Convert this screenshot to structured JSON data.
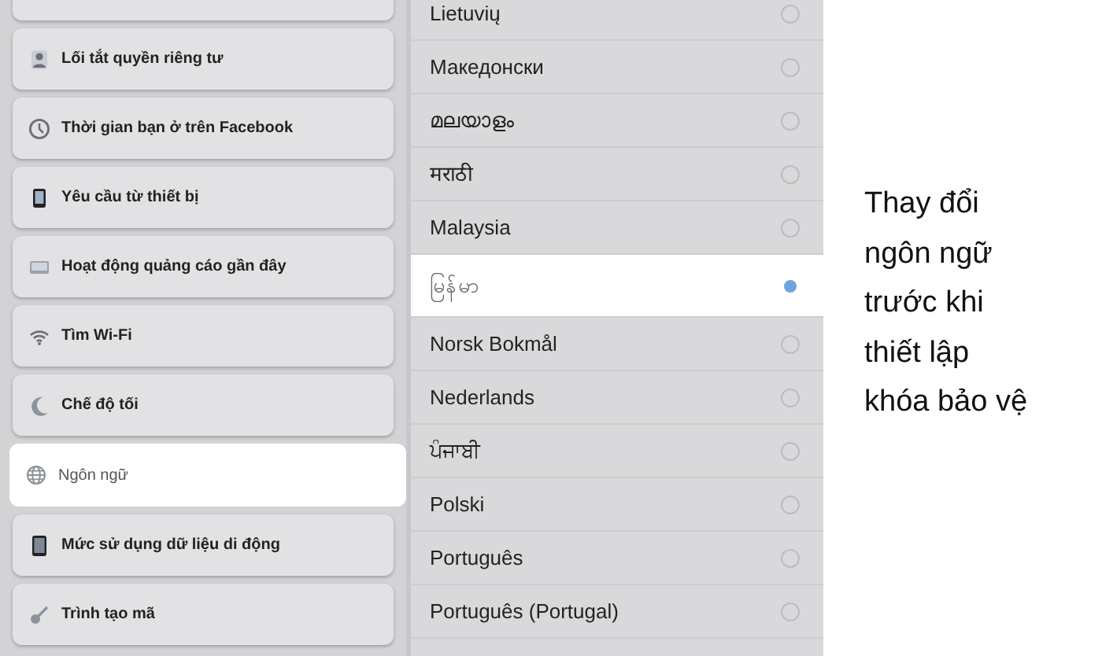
{
  "settings_menu": {
    "items": [
      {
        "label": "Lối tắt quyền riêng tư",
        "kind": "person",
        "selected": false
      },
      {
        "label": "Thời gian bạn ở trên Facebook",
        "kind": "clock",
        "selected": false
      },
      {
        "label": "Yêu cầu từ thiết bị",
        "kind": "phone",
        "selected": false
      },
      {
        "label": "Hoạt động quảng cáo gần đây",
        "kind": "monitor",
        "selected": false
      },
      {
        "label": "Tìm Wi-Fi",
        "kind": "wifi",
        "selected": false
      },
      {
        "label": "Chế độ tối",
        "kind": "moon",
        "selected": false
      },
      {
        "label": "Ngôn ngữ",
        "kind": "globe",
        "selected": true
      },
      {
        "label": "Mức sử dụng dữ liệu di động",
        "kind": "tablet",
        "selected": false
      },
      {
        "label": "Trình tạo mã",
        "kind": "key",
        "selected": false
      }
    ]
  },
  "languages": [
    {
      "label": "Lietuvių",
      "selected": false
    },
    {
      "label": "Македонски",
      "selected": false
    },
    {
      "label": "മലയാളം",
      "selected": false
    },
    {
      "label": "मराठी",
      "selected": false
    },
    {
      "label": "Malaysia",
      "selected": false
    },
    {
      "label": "မြန်မာ",
      "selected": true
    },
    {
      "label": "Norsk Bokmål",
      "selected": false
    },
    {
      "label": "Nederlands",
      "selected": false
    },
    {
      "label": "ਪੰਜਾਬੀ",
      "selected": false
    },
    {
      "label": "Polski",
      "selected": false
    },
    {
      "label": "Português",
      "selected": false
    },
    {
      "label": "Português (Portugal)",
      "selected": false
    }
  ],
  "caption": "Thay đổi ngôn ngữ trước khi thiết lập khóa bảo vệ"
}
